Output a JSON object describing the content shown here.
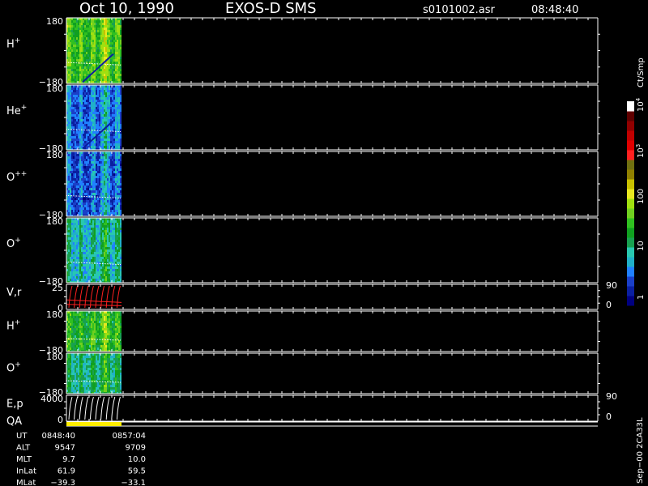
{
  "header": {
    "date": "Oct 10, 1990",
    "mission": "EXOS-D SMS",
    "file": "s0101002.asr",
    "time": "08:48:40"
  },
  "chart_data": {
    "type": "heatmap",
    "panels": [
      {
        "label": "H",
        "sup": "+",
        "ymax": "180",
        "ymin": "−180",
        "base": 0.55,
        "has_slope": true
      },
      {
        "label": "He",
        "sup": "+",
        "ymax": "180",
        "ymin": "−180",
        "base": 0.18,
        "has_slope": true
      },
      {
        "label": "O",
        "sup": "++",
        "ymax": "180",
        "ymin": "−180",
        "base": 0.15,
        "has_slope": false
      },
      {
        "label": "O",
        "sup": "+",
        "ymax": "180",
        "ymin": "−180",
        "base": 0.33,
        "has_slope": false
      },
      {
        "label": "V,r",
        "sup": "",
        "ymax": "25",
        "ymin": "0",
        "right_top": "90",
        "right_bottom": "0",
        "kind": "line",
        "color": "#ff2020"
      },
      {
        "label": "H",
        "sup": "+",
        "ymax": "180",
        "ymin": "−180",
        "base": 0.5,
        "has_slope": false
      },
      {
        "label": "O",
        "sup": "+",
        "ymax": "180",
        "ymin": "−180",
        "base": 0.38,
        "has_slope": false
      },
      {
        "label": "E,p",
        "sup": "",
        "ymax": "4000",
        "ymin": "0",
        "right_top": "90",
        "right_bottom": "0",
        "kind": "line",
        "color": "#ffffff"
      }
    ],
    "qa": {
      "label": "QA",
      "color": "#ffee00"
    },
    "colorbar": {
      "unit": "Ct/Smp",
      "labels": [
        {
          "text": "10",
          "sup": "4"
        },
        {
          "text": "10",
          "sup": "3"
        },
        {
          "text": "100",
          "sup": ""
        },
        {
          "text": "10",
          "sup": ""
        },
        {
          "text": "1",
          "sup": ""
        }
      ],
      "colors": [
        "#000080",
        "#0a1fa0",
        "#1a3fc8",
        "#2080ff",
        "#20b0c8",
        "#28c8b0",
        "#18a050",
        "#10a020",
        "#30c020",
        "#70d020",
        "#a0e010",
        "#e8e820",
        "#c8c000",
        "#908000",
        "#707010",
        "#ff2020",
        "#e00000",
        "#c00000",
        "#900000",
        "#600000",
        "#ffffff"
      ]
    },
    "orbit_table": {
      "rows": [
        {
          "label": "UT",
          "start": "0848:40",
          "end": "0857:04"
        },
        {
          "label": "ALT",
          "start": "9547",
          "end": "9709"
        },
        {
          "label": "MLT",
          "start": "9.7",
          "end": "10.0"
        },
        {
          "label": "InLat",
          "start": "61.9",
          "end": "59.5"
        },
        {
          "label": "MLat",
          "start": "−39.3",
          "end": "−33.1"
        }
      ]
    },
    "footer_code": "Sep−00 2CA33L"
  }
}
